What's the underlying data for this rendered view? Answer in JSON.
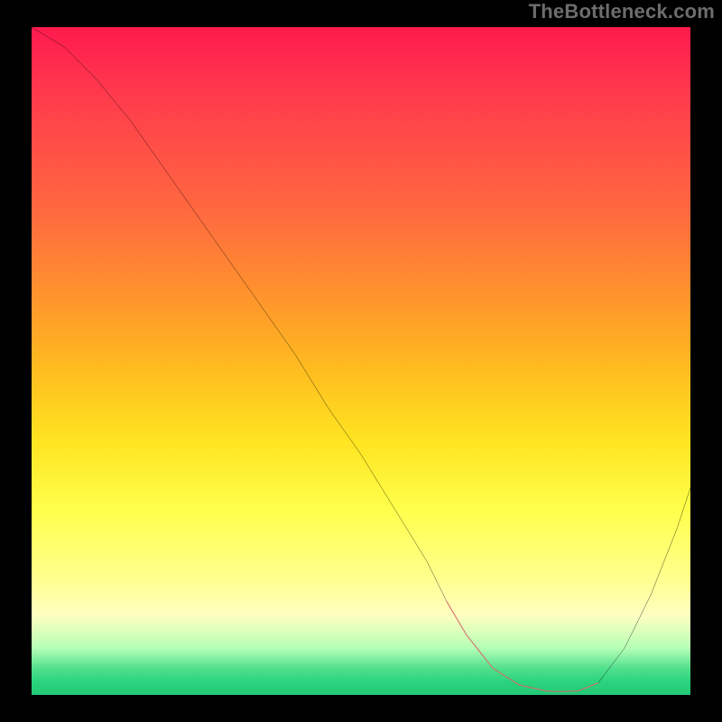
{
  "watermark": "TheBottleneck.com",
  "chart_data": {
    "type": "line",
    "title": "",
    "xlabel": "",
    "ylabel": "",
    "xlim": [
      0,
      100
    ],
    "ylim": [
      0,
      100
    ],
    "grid": false,
    "legend": false,
    "series": [
      {
        "name": "curve",
        "color": "#000000",
        "stroke_width": 2,
        "x": [
          0,
          5,
          10,
          15,
          20,
          25,
          30,
          35,
          40,
          45,
          50,
          55,
          60,
          63,
          66,
          70,
          74,
          78,
          80,
          83,
          86,
          90,
          94,
          98,
          100
        ],
        "y": [
          100,
          97,
          92,
          86,
          79,
          72,
          65,
          58,
          51,
          43,
          36,
          28,
          20,
          14,
          9,
          4,
          1.5,
          0.6,
          0.5,
          0.6,
          1.8,
          7,
          15,
          25,
          31
        ]
      },
      {
        "name": "flat-highlight",
        "color": "#e06666",
        "stroke_width": 6,
        "dash": "9 6",
        "x": [
          63,
          66,
          70,
          74,
          78,
          80,
          83,
          86
        ],
        "y": [
          14,
          9,
          4,
          1.5,
          0.6,
          0.5,
          0.6,
          1.8
        ]
      }
    ],
    "background": "rainbow-vertical-red-to-green"
  }
}
